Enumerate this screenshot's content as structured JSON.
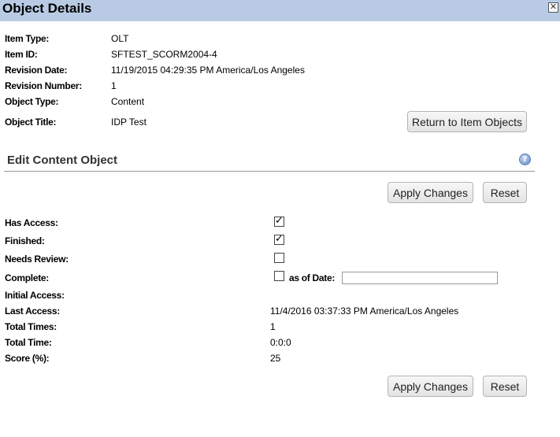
{
  "window": {
    "title": "Object Details",
    "close_icon": "close-icon"
  },
  "details": [
    {
      "label": "Item Type:",
      "value": "OLT"
    },
    {
      "label": "Item ID:",
      "value": "SFTEST_SCORM2004-4"
    },
    {
      "label": "Revision Date:",
      "value": "11/19/2015 04:29:35 PM America/Los Angeles"
    },
    {
      "label": "Revision Number:",
      "value": "1"
    },
    {
      "label": "Object Type:",
      "value": "Content"
    },
    {
      "label": "Object Title:",
      "value": "IDP Test"
    }
  ],
  "buttons": {
    "return_label": "Return to Item Objects",
    "apply_label": "Apply Changes",
    "reset_label": "Reset"
  },
  "edit_section": {
    "title": "Edit Content Object",
    "help_icon": "help-icon",
    "fields": {
      "has_access": {
        "label": "Has Access:",
        "checked": true
      },
      "finished": {
        "label": "Finished:",
        "checked": true
      },
      "needs_review": {
        "label": "Needs Review:",
        "checked": false
      },
      "complete": {
        "label": "Complete:",
        "checked": false,
        "as_of_label": "as of Date:",
        "as_of_value": ""
      },
      "initial_access": {
        "label": "Initial Access:",
        "value": ""
      },
      "last_access": {
        "label": "Last Access:",
        "value": "11/4/2016 03:37:33 PM America/Los Angeles"
      },
      "total_times": {
        "label": "Total Times:",
        "value": "1"
      },
      "total_time": {
        "label": "Total Time:",
        "value": "0:0:0"
      },
      "score": {
        "label": "Score (%):",
        "value": "25"
      }
    }
  }
}
